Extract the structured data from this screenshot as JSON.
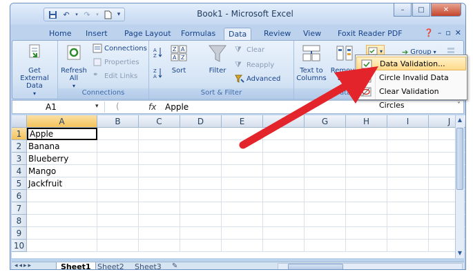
{
  "window": {
    "title": "Book1 - Microsoft Excel"
  },
  "qat": {
    "items": [
      "save-icon",
      "undo-icon",
      "redo-icon",
      "new-icon"
    ]
  },
  "tabs": [
    "Home",
    "Insert",
    "Page Layout",
    "Formulas",
    "Data",
    "Review",
    "View",
    "Foxit Reader PDF"
  ],
  "active_tab": "Data",
  "ribbon": {
    "get_external_data": "Get External Data",
    "refresh_all": "Refresh All",
    "connections": "Connections",
    "properties": "Properties",
    "edit_links": "Edit Links",
    "connections_group": "Connections",
    "sort": "Sort",
    "filter": "Filter",
    "clear": "Clear",
    "reapply": "Reapply",
    "advanced": "Advanced",
    "sort_filter_group": "Sort & Filter",
    "text_to_columns": "Text to Columns",
    "remove_duplicates": "Remove Dup",
    "data_tools_group": "Data T",
    "group": "Group"
  },
  "formula_bar": {
    "name_box": "A1",
    "fx": "fx",
    "value": "Apple"
  },
  "grid": {
    "columns": [
      "A",
      "B",
      "C",
      "D",
      "E",
      "F",
      "G",
      "H",
      "I",
      "J"
    ],
    "rows": [
      "1",
      "2",
      "3",
      "4",
      "5",
      "6",
      "7",
      "8",
      "9",
      "10"
    ],
    "values": [
      "Apple",
      "Banana",
      "Blueberry",
      "Mango",
      "Jackfruit"
    ]
  },
  "sheets": [
    "Sheet1",
    "Sheet2",
    "Sheet3"
  ],
  "menu": {
    "items": [
      "Data Validation...",
      "Circle Invalid Data",
      "Clear Validation Circles"
    ]
  },
  "colors": {
    "accent": "#15428b",
    "arrow": "#e3242b",
    "highlight": "#ffd98a"
  }
}
